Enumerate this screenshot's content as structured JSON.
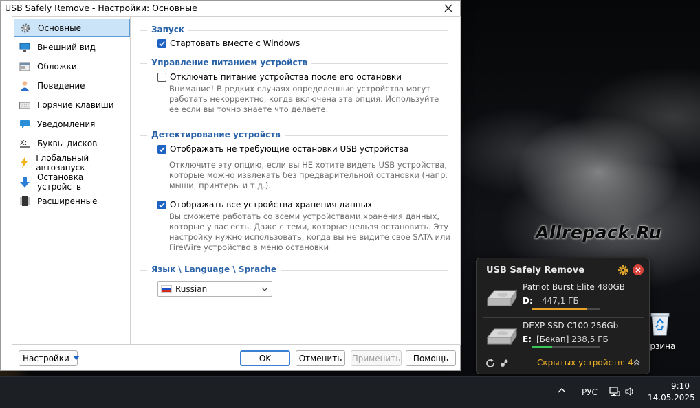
{
  "window": {
    "title": "USB Safely Remove - Настройки: Основные"
  },
  "nav": {
    "items": [
      {
        "label": "Основные",
        "icon": "gear-icon",
        "active": true
      },
      {
        "label": "Внешний вид",
        "icon": "monitor-icon"
      },
      {
        "label": "Обложки",
        "icon": "skin-icon"
      },
      {
        "label": "Поведение",
        "icon": "person-icon"
      },
      {
        "label": "Горячие клавиши",
        "icon": "keyboard-icon"
      },
      {
        "label": "Уведомления",
        "icon": "notification-icon"
      },
      {
        "label": "Буквы дисков",
        "icon": "drive-letter-icon"
      },
      {
        "label": "Глобальный автозапуск",
        "icon": "lightning-icon"
      },
      {
        "label": "Остановка устройств",
        "icon": "down-arrow-icon"
      },
      {
        "label": "Расширенные",
        "icon": "chip-icon"
      }
    ]
  },
  "sections": {
    "startup": "Запуск",
    "power": "Управление питанием устройств",
    "detect": "Детектирование устройств",
    "language": "Язык \\ Language \\ Sprache"
  },
  "options": {
    "startup_label": "Стартовать вместе с Windows",
    "startup_checked": true,
    "power_label": "Отключать питание устройства после его остановки",
    "power_checked": false,
    "power_desc": "Внимание! В редких случаях определенные устройства могут работать некорректно, когда включена эта опция. Используйте ее если вы точно знаете что делаете.",
    "show_nonstop_label": "Отображать не требующие остановки USB устройства",
    "show_nonstop_checked": true,
    "show_nonstop_desc": "Отключите эту опцию, если вы НЕ хотите видеть USB устройства, которые можно извлекать без предварительной остановки (напр. мыши, принтеры и т.д.).",
    "show_storage_label": "Отображать все устройства хранения данных",
    "show_storage_checked": true,
    "show_storage_desc": "Вы сможете работать со всеми устройствами хранения данных, которые у вас есть. Даже с теми, которые нельзя остановить. Эту настройку нужно использовать, когда вы не видите свое SATA или FireWire устройство в меню остановки",
    "language_value": "Russian"
  },
  "footer": {
    "settings_menu": "Настройки",
    "ok": "OK",
    "cancel": "Отменить",
    "apply": "Применить",
    "help": "Помощь"
  },
  "popup": {
    "title": "USB Safely Remove",
    "devices": [
      {
        "name": "Patriot Burst Elite 480GB",
        "letter": "D:",
        "label": "",
        "size": "447,1 ГБ",
        "fill": 0.8,
        "color": "#e8a22a"
      },
      {
        "name": "DEXP SSD C100 256Gb",
        "letter": "E:",
        "label": "[Бекап]",
        "size": "238,5 ГБ",
        "fill": 0.3,
        "color": "#3cc55a"
      }
    ],
    "hidden": "Скрытых устройств: 4"
  },
  "desktop": {
    "watermark": "Allrepack.Ru",
    "recycle_label": "орзина"
  },
  "taskbar": {
    "lang": "РУС",
    "time": "9:10",
    "date": "14.05.2025"
  }
}
